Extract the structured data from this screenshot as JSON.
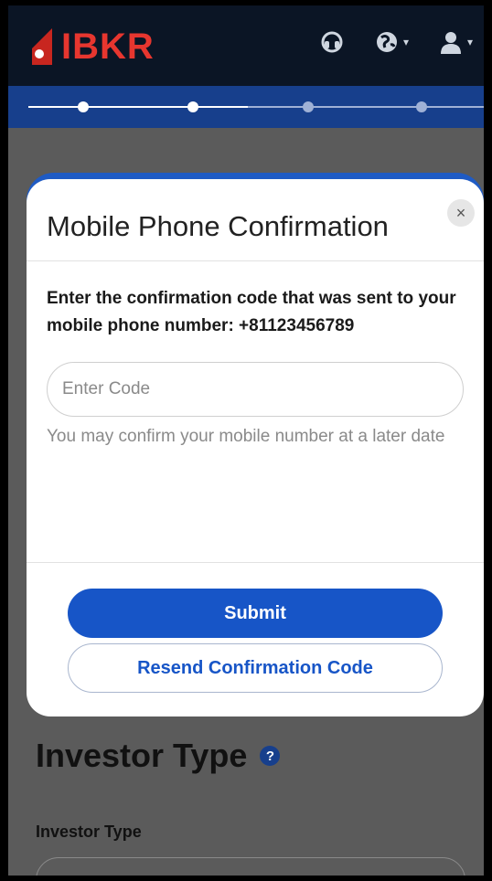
{
  "header": {
    "brand": "IBKR",
    "icons": [
      "support-icon",
      "globe-icon",
      "user-icon"
    ]
  },
  "progress": {
    "total_steps": 4,
    "completed_steps": 2
  },
  "modal": {
    "title": "Mobile Phone Confirmation",
    "close_label": "×",
    "message": "Enter the confirmation code that was sent to your mobile phone number: +81123456789",
    "code_placeholder": "Enter Code",
    "code_value": "",
    "hint": "You may confirm your mobile number at a later date",
    "submit_label": "Submit",
    "resend_label": "Resend Confirmation Code"
  },
  "page": {
    "title": "Investor Type",
    "help_icon": "?",
    "field_label": "Investor Type"
  },
  "colors": {
    "topbar": "#0b1525",
    "brand_red": "#e7362f",
    "progress_bar": "#173f8c",
    "primary_button": "#1755c7"
  }
}
